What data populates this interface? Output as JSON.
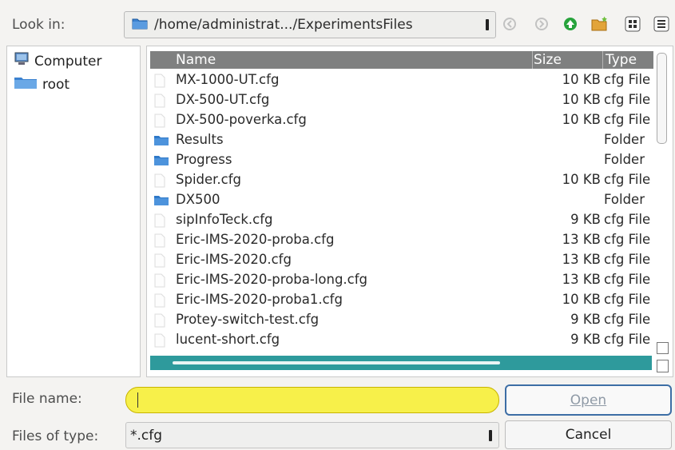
{
  "look_in": {
    "label": "Look in:",
    "path": "/home/administrat.../ExperimentsFiles"
  },
  "sidebar": {
    "items": [
      {
        "label": "Computer"
      },
      {
        "label": "root"
      }
    ]
  },
  "columns": {
    "name": "Name",
    "size": "Size",
    "type": "Type"
  },
  "files": [
    {
      "name": "MX-1000-UT.cfg",
      "size": "10 KB",
      "type": "cfg File",
      "kind": "file"
    },
    {
      "name": "DX-500-UT.cfg",
      "size": "10 KB",
      "type": "cfg File",
      "kind": "file"
    },
    {
      "name": "DX-500-poverka.cfg",
      "size": "10 KB",
      "type": "cfg File",
      "kind": "file"
    },
    {
      "name": "Results",
      "size": "",
      "type": "Folder",
      "kind": "folder"
    },
    {
      "name": "Progress",
      "size": "",
      "type": "Folder",
      "kind": "folder"
    },
    {
      "name": "Spider.cfg",
      "size": "10 KB",
      "type": "cfg File",
      "kind": "file"
    },
    {
      "name": "DX500",
      "size": "",
      "type": "Folder",
      "kind": "folder"
    },
    {
      "name": "sipInfoTeck.cfg",
      "size": "9 KB",
      "type": "cfg File",
      "kind": "file"
    },
    {
      "name": "Eric-IMS-2020-proba.cfg",
      "size": "13 KB",
      "type": "cfg File",
      "kind": "file"
    },
    {
      "name": "Eric-IMS-2020.cfg",
      "size": "13 KB",
      "type": "cfg File",
      "kind": "file"
    },
    {
      "name": "Eric-IMS-2020-proba-long.cfg",
      "size": "13 KB",
      "type": "cfg File",
      "kind": "file"
    },
    {
      "name": "Eric-IMS-2020-proba1.cfg",
      "size": "10 KB",
      "type": "cfg File",
      "kind": "file"
    },
    {
      "name": "Protey-switch-test.cfg",
      "size": "9 KB",
      "type": "cfg File",
      "kind": "file"
    },
    {
      "name": "lucent-short.cfg",
      "size": "9 KB",
      "type": "cfg File",
      "kind": "file"
    }
  ],
  "file_name": {
    "label": "File name:",
    "value": ""
  },
  "file_type": {
    "label": "Files of type:",
    "value": "*.cfg"
  },
  "buttons": {
    "open": "Open",
    "cancel": "Cancel"
  },
  "colors": {
    "header": "#7f8080",
    "scrollbar": "#2e9a9c",
    "input_highlight": "#f7f04a",
    "folder": "#2f79c9"
  }
}
